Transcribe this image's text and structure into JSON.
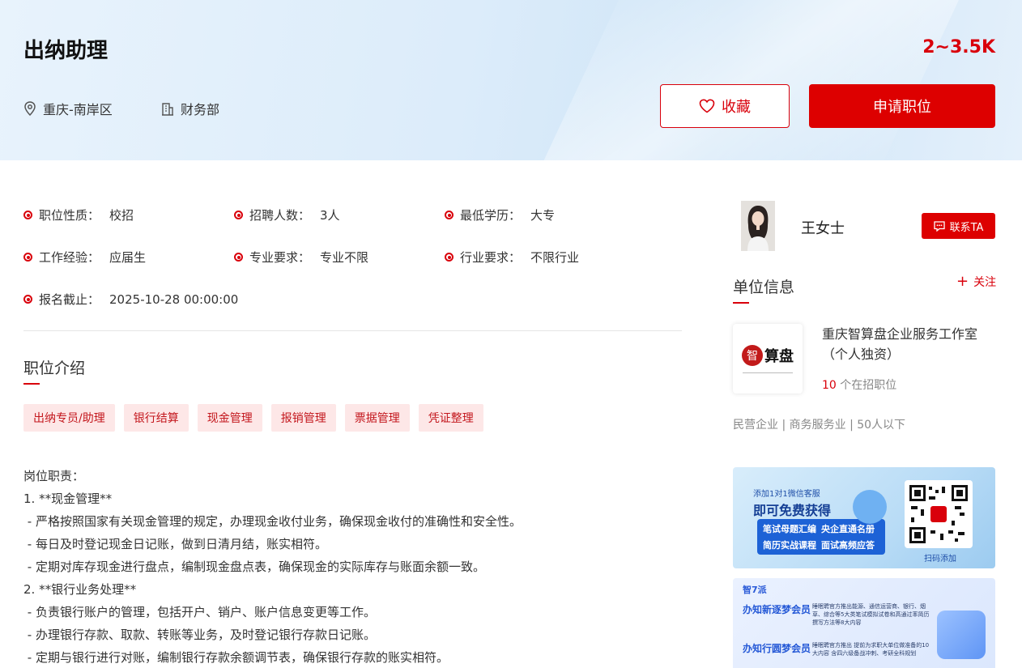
{
  "header": {
    "job_title": "出纳助理",
    "salary": "2~3.5K",
    "location": "重庆-南岸区",
    "department": "财务部",
    "favorite_label": "收藏",
    "apply_label": "申请职位"
  },
  "attributes": [
    {
      "label": "职位性质：",
      "value": "校招"
    },
    {
      "label": "招聘人数：",
      "value": "3人"
    },
    {
      "label": "最低学历：",
      "value": "大专"
    },
    {
      "label": "工作经验：",
      "value": "应届生"
    },
    {
      "label": "专业要求：",
      "value": "专业不限"
    },
    {
      "label": "行业要求：",
      "value": "不限行业"
    },
    {
      "label": "报名截止：",
      "value": "2025-10-28 00:00:00"
    }
  ],
  "intro": {
    "title": "职位介绍",
    "tags": [
      "出纳专员/助理",
      "银行结算",
      "现金管理",
      "报销管理",
      "票据管理",
      "凭证整理"
    ],
    "description": "岗位职责：\n1. **现金管理**\n - 严格按照国家有关现金管理的规定，办理现金收付业务，确保现金收付的准确性和安全性。\n - 每日及时登记现金日记账，做到日清月结，账实相符。\n - 定期对库存现金进行盘点，编制现金盘点表，确保现金的实际库存与账面余额一致。\n2. **银行业务处理**\n - 负责银行账户的管理，包括开户、销户、账户信息变更等工作。\n - 办理银行存款、取款、转账等业务，及时登记银行存款日记账。\n - 定期与银行进行对账，编制银行存款余额调节表，确保银行存款的账实相符。"
  },
  "contact": {
    "name": "王女士",
    "button_label": "联系TA"
  },
  "company": {
    "section_title": "单位信息",
    "follow_label": "关注",
    "name": "重庆智算盘企业服务工作室（个人独资）",
    "logo_text": "智算盘",
    "open_jobs_count": "10",
    "open_jobs_suffix": " 个在招职位",
    "info": "民营企业 | 商务服务业 | 50人以下"
  },
  "ads": {
    "ad1": {
      "line1": "添加1对1微信客服",
      "line2": "即可免费获得",
      "btn1": "笔试母题汇编",
      "btn2": "央企直通名册",
      "btn3": "简历实战课程",
      "btn4": "面试高频应答",
      "scan": "扫码添加"
    },
    "ad2": {
      "brand": "智7派",
      "row1_title": "办知新逐梦会员",
      "row1_text": "睡眠聘官方推出能源、通信运营商、银行、烟草、综合等5大类笔试模拟试卷和高通过率简历撰写方法等8大内容",
      "row2_title": "办知行圆梦会员",
      "row2_text": "睡眠聘官方推出 提前为求职大单位做准备的10大内容 含四六级备战冲刺、考研全科规划"
    }
  },
  "colors": {
    "accent": "#dd0000",
    "tag_bg": "#fde7e7"
  }
}
